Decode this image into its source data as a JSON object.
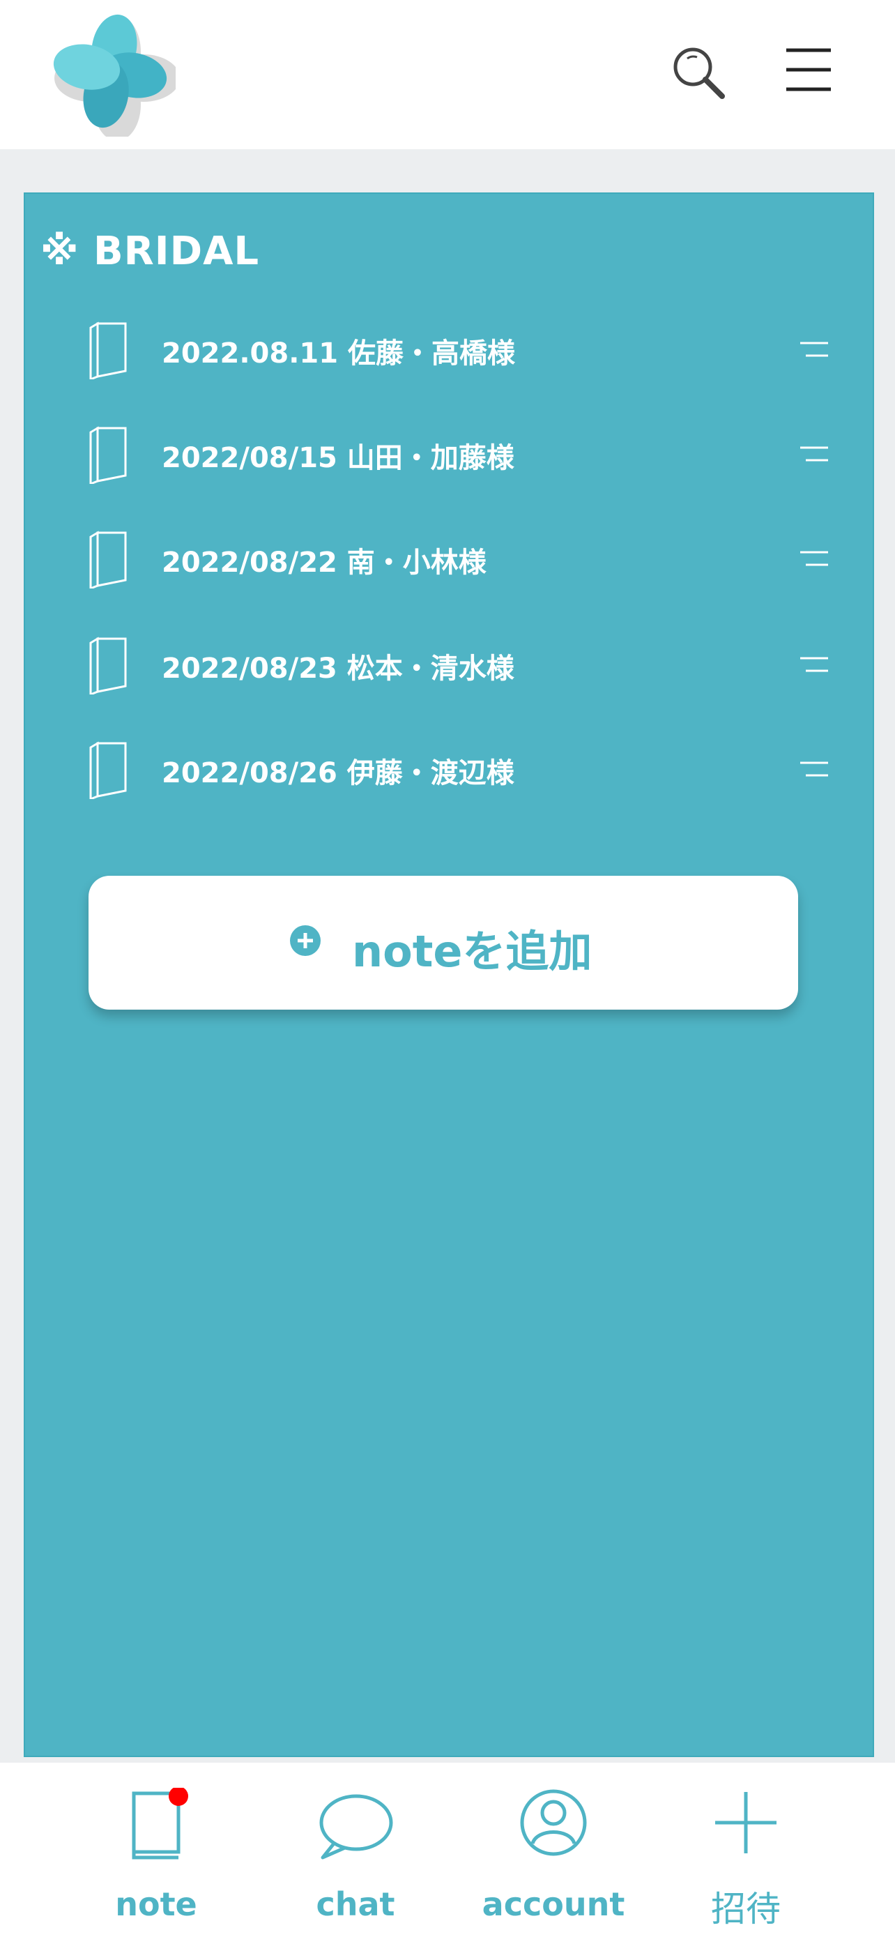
{
  "colors": {
    "accent": "#4fb4c5",
    "header_bg": "#ffffff",
    "page_bg": "#eceef0",
    "badge": "#ff0000"
  },
  "header": {
    "logo_icon": "clover-logo-icon",
    "search_icon": "search-icon",
    "menu_icon": "hamburger-menu-icon"
  },
  "section": {
    "title": "※ BRIDAL"
  },
  "notes": [
    {
      "label": "2022.08.11 佐藤・高橋様"
    },
    {
      "label": "2022/08/15 山田・加藤様"
    },
    {
      "label": "2022/08/22 南・小林様"
    },
    {
      "label": "2022/08/23 松本・清水様"
    },
    {
      "label": "2022/08/26 伊藤・渡辺様"
    }
  ],
  "add_note": {
    "label": "noteを追加",
    "icon": "plus-circle-icon"
  },
  "tabbar": {
    "tabs": [
      {
        "label": "note",
        "icon": "note-book-icon",
        "badge": true
      },
      {
        "label": "chat",
        "icon": "chat-bubble-icon"
      },
      {
        "label": "account",
        "icon": "account-person-icon"
      },
      {
        "label": "招待",
        "icon": "plus-icon"
      }
    ]
  }
}
